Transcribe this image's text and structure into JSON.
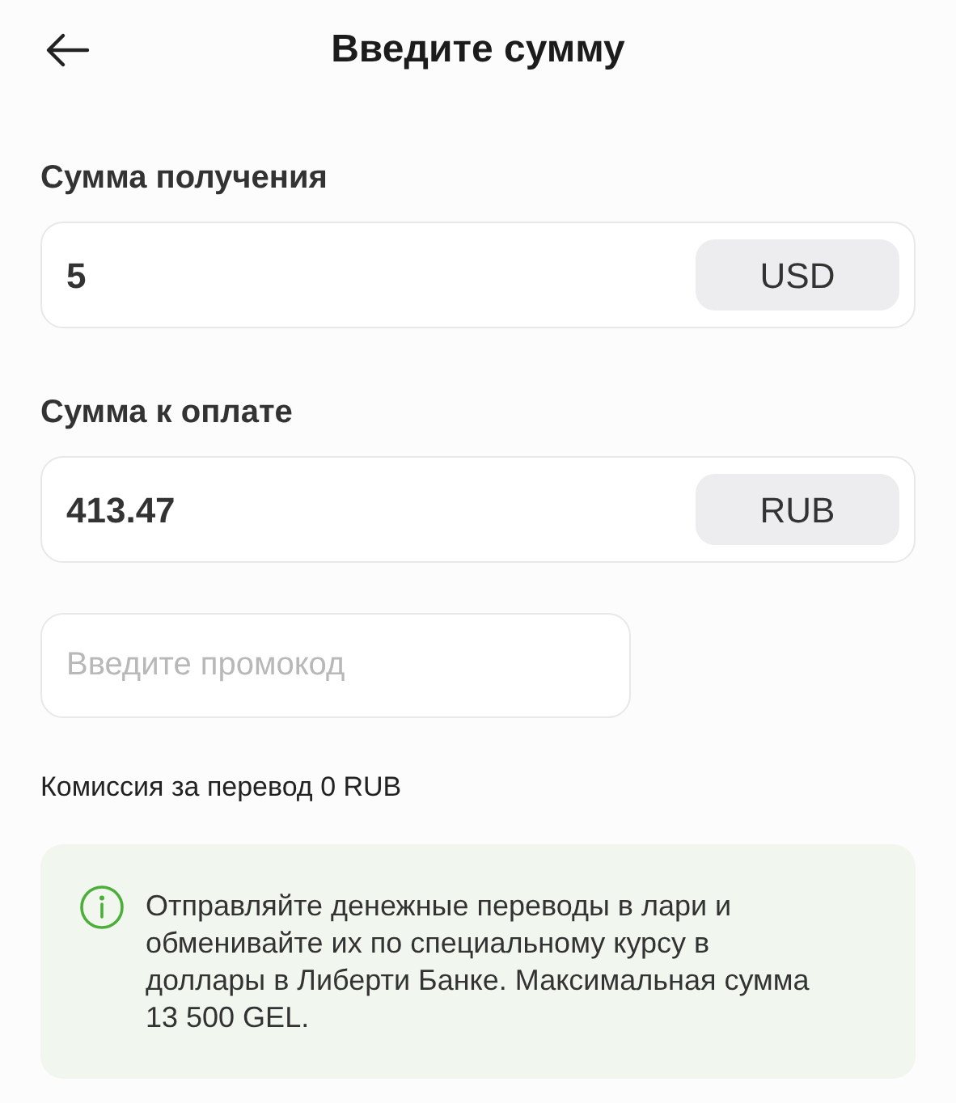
{
  "header": {
    "title": "Введите сумму"
  },
  "receive": {
    "label": "Сумма получения",
    "value": "5",
    "currency": "USD"
  },
  "pay": {
    "label": "Сумма к оплате",
    "value": "413.47",
    "currency": "RUB"
  },
  "promo": {
    "placeholder": "Введите промокод"
  },
  "commission": "Комиссия за перевод 0 RUB",
  "info": {
    "text": "Отправляйте денежные переводы в лари и обменивайте их по специальному курсу в доллары в Либерти Банке. Максимальная сумма 13 500 GEL."
  }
}
